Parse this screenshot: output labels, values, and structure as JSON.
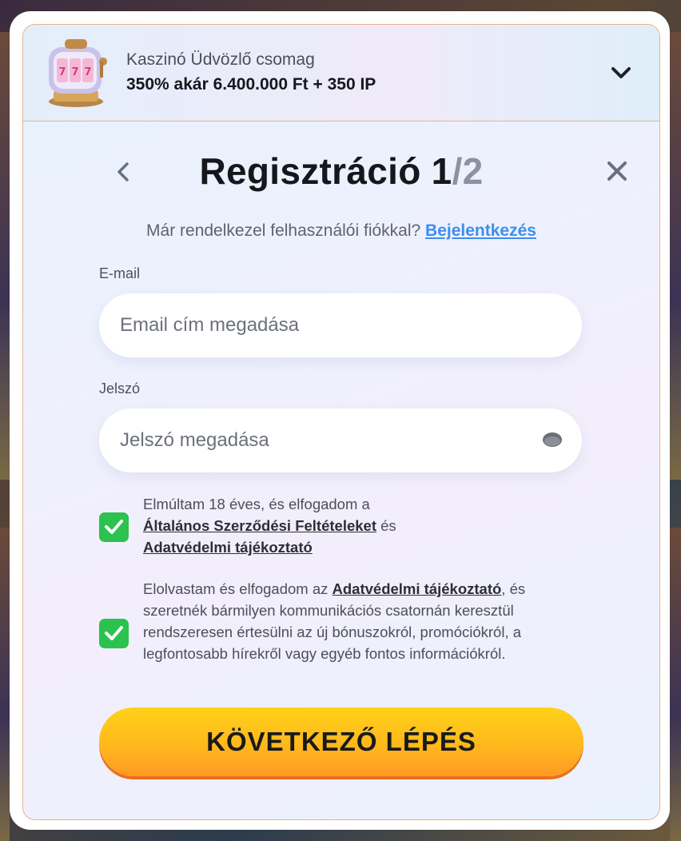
{
  "promo": {
    "title": "Kaszinó Üdvözlő csomag",
    "bonus": "350% akár 6.400.000 Ft + 350 IP",
    "toggle_icon": "chevron-down-icon",
    "image_icon": "slot-machine-icon"
  },
  "form": {
    "title_main": "Regisztráció 1",
    "title_sep": "/2",
    "back_icon": "chevron-left-icon",
    "close_icon": "close-icon",
    "login_prompt": "Már rendelkezel felhasználói fiókkal?",
    "login_link": "Bejelentkezés",
    "email_label": "E-mail",
    "email_placeholder": "Email cím megadása",
    "password_label": "Jelszó",
    "password_placeholder": "Jelszó megadása",
    "password_toggle_icon": "eye-icon",
    "consent1": {
      "checked": true,
      "line1": "Elmúltam 18 éves, és elfogadom a",
      "terms_link": "Általános Szerződési Feltételeket",
      "and": "és",
      "privacy_link": "Adatvédelmi tájékoztató"
    },
    "consent2": {
      "checked": true,
      "prefix": "Elolvastam és elfogadom az",
      "privacy_link": "Adatvédelmi tájékoztató",
      "rest": ", és szeretnék bármilyen kommunikációs csatornán keresztül rendszeresen értesülni az új bónuszokról, promóciókról, a legfontosabb hírekről vagy egyéb fontos információkról."
    },
    "next_button": "KÖVETKEZŐ LÉPÉS"
  },
  "colors": {
    "accent_link": "#3d8ef0",
    "checkbox": "#2bc24f",
    "button_top": "#ffd21a",
    "button_bottom": "#ff9a24",
    "border": "#e7b48a"
  }
}
